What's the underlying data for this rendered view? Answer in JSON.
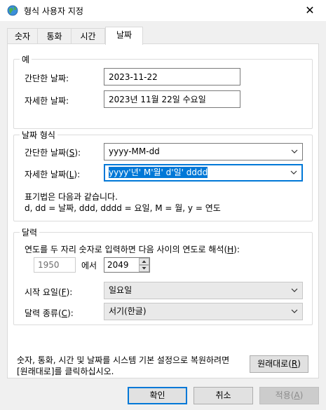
{
  "window": {
    "title": "형식 사용자 지정",
    "close_glyph": "✕",
    "icon": "globe-icon"
  },
  "tabs": [
    {
      "label": "숫자"
    },
    {
      "label": "통화"
    },
    {
      "label": "시간"
    },
    {
      "label": "날짜"
    }
  ],
  "examples": {
    "legend": "예",
    "short_label": "간단한 날짜:",
    "short_value": "2023-11-22",
    "long_label": "자세한 날짜:",
    "long_value": "2023년 11월 22일 수요일"
  },
  "formats": {
    "legend": "날짜 형식",
    "short_label": "간단한 날짜(",
    "short_key": "S",
    "short_label_end": "):",
    "short_value": "yyyy-MM-dd",
    "long_label": "자세한 날짜(",
    "long_key": "L",
    "long_label_end": "):",
    "long_value": "yyyy'년' M'월' d'일' dddd",
    "notation_line1": "표기법은 다음과 같습니다.",
    "notation_line2": "d, dd = 날짜,  ddd, dddd = 요일,  M = 월,  y = 연도"
  },
  "calendar": {
    "legend": "달력",
    "two_digit_label": "연도를 두 자리 숫자로 입력하면 다음 사이의 연도로 해석(",
    "two_digit_key": "H",
    "two_digit_end": "):",
    "from_year": "1950",
    "between": "에서",
    "to_year": "2049",
    "first_day_label": "시작 요일(",
    "first_day_key": "F",
    "first_day_end": "):",
    "first_day_value": "일요일",
    "cal_type_label": "달력 종류(",
    "cal_type_key": "C",
    "cal_type_end": "):",
    "cal_type_value": "서기(한글)"
  },
  "reset": {
    "line1": "숫자, 통화, 시간 및 날짜를 시스템 기본 설정으로 복원하려면",
    "line2": "[원래대로]를 클릭하십시오.",
    "button_label": "원래대로(",
    "button_key": "R",
    "button_end": ")"
  },
  "footer": {
    "ok": "확인",
    "cancel": "취소",
    "apply_label": "적용(",
    "apply_key": "A",
    "apply_end": ")"
  },
  "colors": {
    "accent": "#0078d7",
    "panel": "#ffffff",
    "window": "#f0f0f0"
  }
}
